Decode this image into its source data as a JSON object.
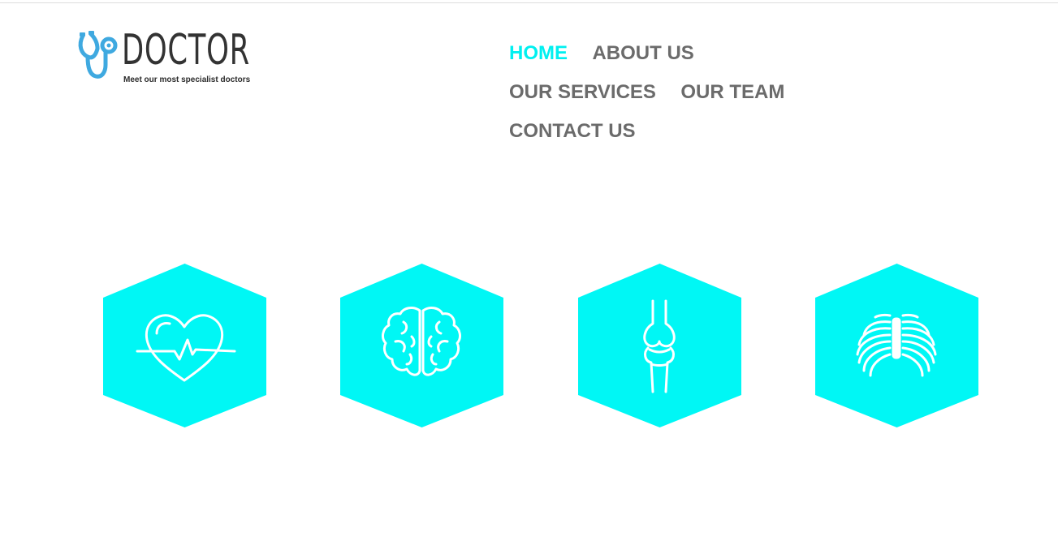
{
  "header": {
    "logo": {
      "title": "DOCTOR",
      "tagline": "Meet our most specialist doctors",
      "icon": "stethoscope-icon"
    },
    "nav": [
      {
        "label": "HOME",
        "active": true
      },
      {
        "label": "ABOUT US",
        "active": false
      },
      {
        "label": "OUR SERVICES",
        "active": false
      },
      {
        "label": "OUR TEAM",
        "active": false
      },
      {
        "label": "CONTACT US",
        "active": false
      }
    ]
  },
  "specialties": [
    {
      "icon": "heart-pulse-icon"
    },
    {
      "icon": "brain-icon"
    },
    {
      "icon": "bone-joint-icon"
    },
    {
      "icon": "rib-cage-icon"
    }
  ],
  "colors": {
    "accent": "#00f7f5",
    "nav_text": "#6b6b6b",
    "nav_active": "#00f0f0",
    "logo_blue": "#3fa9e0",
    "logo_text": "#333333"
  }
}
